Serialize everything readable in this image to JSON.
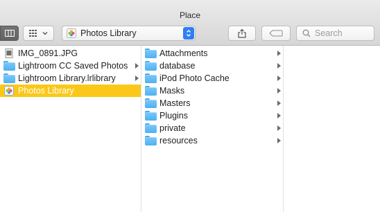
{
  "window": {
    "title": "Place"
  },
  "toolbar": {
    "path_popup_label": "Photos Library",
    "search_placeholder": "Search"
  },
  "columns": {
    "col1": [
      {
        "name": "IMG_0891.JPG",
        "kind": "file",
        "icon": "jpg-file-icon",
        "has_children": false,
        "selected": false
      },
      {
        "name": "Lightroom CC Saved Photos",
        "kind": "folder",
        "icon": "folder-icon",
        "has_children": true,
        "selected": false
      },
      {
        "name": "Lightroom Library.lrlibrary",
        "kind": "folder",
        "icon": "folder-icon",
        "has_children": true,
        "selected": false
      },
      {
        "name": "Photos Library",
        "kind": "library",
        "icon": "photos-library-icon",
        "has_children": true,
        "selected": true
      }
    ],
    "col2": [
      {
        "name": "Attachments",
        "kind": "folder",
        "icon": "folder-icon",
        "has_children": true
      },
      {
        "name": "database",
        "kind": "folder",
        "icon": "folder-icon",
        "has_children": true
      },
      {
        "name": "iPod Photo Cache",
        "kind": "folder",
        "icon": "folder-icon",
        "has_children": true
      },
      {
        "name": "Masks",
        "kind": "folder",
        "icon": "folder-icon",
        "has_children": true
      },
      {
        "name": "Masters",
        "kind": "folder",
        "icon": "folder-icon",
        "has_children": true
      },
      {
        "name": "Plugins",
        "kind": "folder",
        "icon": "folder-icon",
        "has_children": true
      },
      {
        "name": "private",
        "kind": "folder",
        "icon": "folder-icon",
        "has_children": true
      },
      {
        "name": "resources",
        "kind": "folder",
        "icon": "folder-icon",
        "has_children": true
      }
    ]
  },
  "colors": {
    "selection": "#fbc81a",
    "folder": "#5fb8f3",
    "accent": "#2f7ef6"
  }
}
